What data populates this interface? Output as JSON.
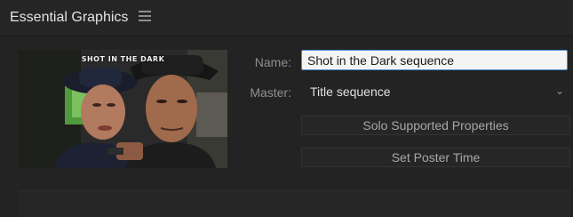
{
  "panel": {
    "title": "Essential Graphics",
    "menu_icon": "hamburger-menu-icon"
  },
  "thumbnail": {
    "caption": "SHOT IN THE DARK"
  },
  "fields": {
    "name_label": "Name:",
    "name_value": "Shot in the Dark sequence",
    "master_label": "Master:",
    "master_value": "Title sequence",
    "master_chevron": "⌄"
  },
  "buttons": {
    "solo_label": "Solo Supported Properties",
    "poster_label": "Set Poster Time"
  },
  "colors": {
    "accent_focus": "#4a8fd8",
    "panel_bg": "#232323"
  }
}
